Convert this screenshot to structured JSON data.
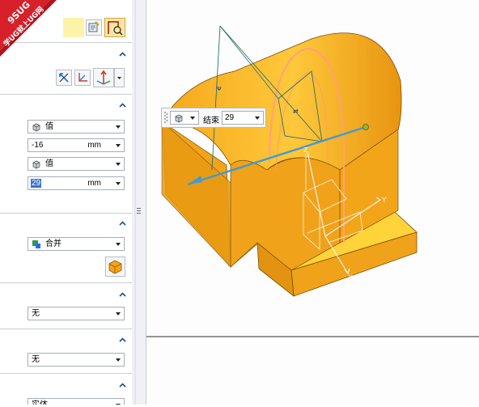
{
  "logo": {
    "line1": "9SUG",
    "line2": "学UG就上UG网",
    "bg": "#d8202a"
  },
  "colors": {
    "part_orange": "#f0a21a",
    "part_light": "#ffc524",
    "axis_blue": "#3f9ad6",
    "highlight_field": "#fdf3a8"
  },
  "start": {
    "type_value": "值",
    "distance_value": "-16",
    "unit": "mm"
  },
  "end": {
    "type_value": "值",
    "distance_value": "29",
    "unit": "mm"
  },
  "boolean": {
    "value": "合并"
  },
  "draft": {
    "value": "无"
  },
  "offset": {
    "value": "无"
  },
  "settings": {
    "value": "实体"
  },
  "floatbar": {
    "type_icon": "cube-icon",
    "label": "结束",
    "value": "29"
  },
  "axes": {
    "x": "X",
    "y": "Y",
    "z": "Z"
  }
}
